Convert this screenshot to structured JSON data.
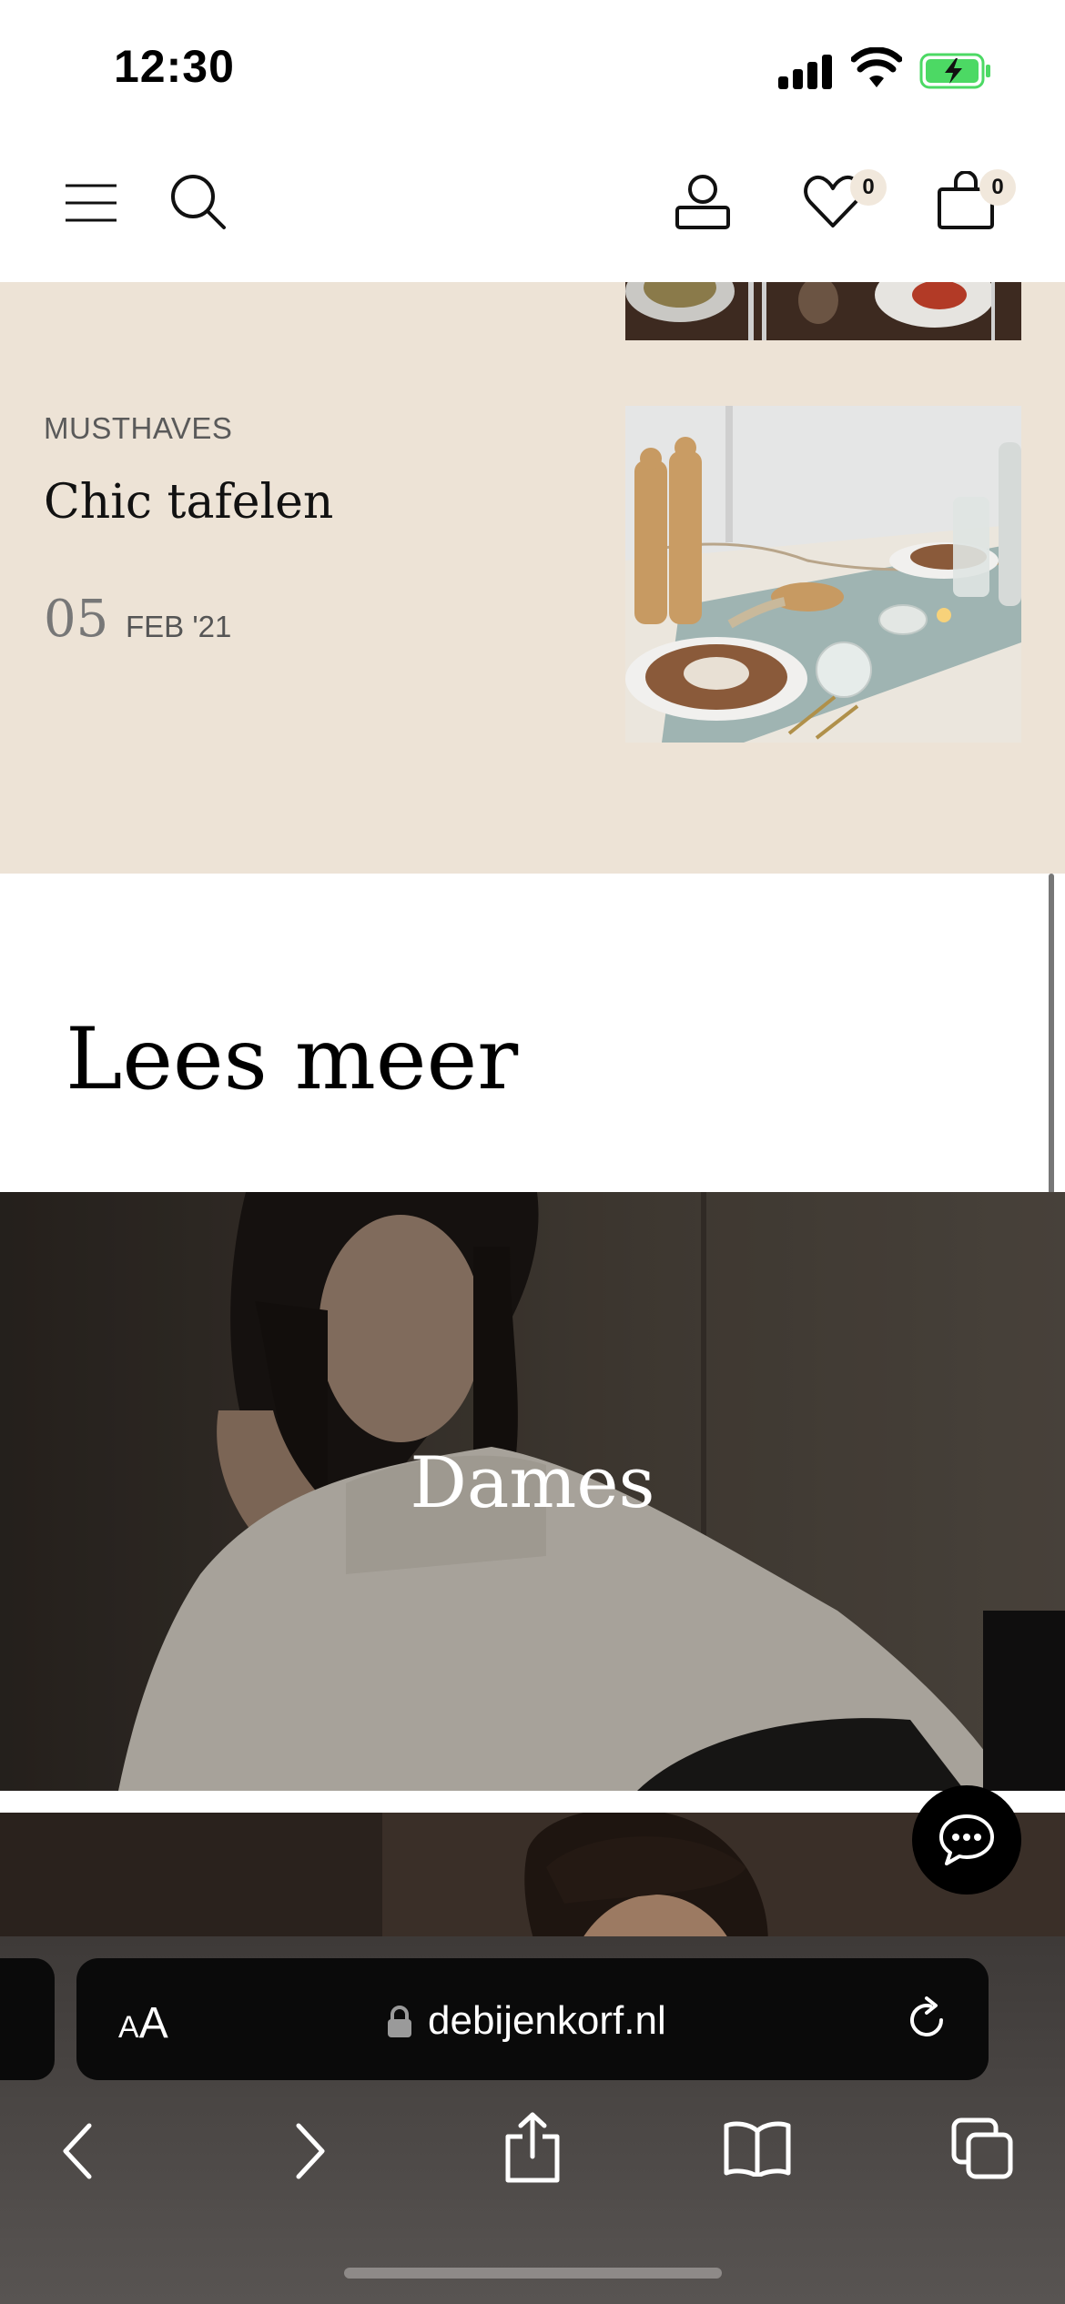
{
  "status_bar": {
    "time": "12:30"
  },
  "header": {
    "wishlist_count": "0",
    "cart_count": "0"
  },
  "article": {
    "category": "MUSTHAVES",
    "title": "Chic tafelen",
    "day": "05",
    "month_year": "FEB '21"
  },
  "read_more": {
    "heading": "Lees meer"
  },
  "banners": {
    "dames_label": "Dames"
  },
  "browser": {
    "aa_small": "A",
    "aa_large": "A",
    "url": "debijenkorf.nl"
  },
  "colors": {
    "beige_background": "#ede3d6",
    "badge_background": "#f1e8dc",
    "battery_green": "#4cd964",
    "browser_chrome": "#484442"
  },
  "icons": [
    "menu-icon",
    "search-icon",
    "account-icon",
    "heart-icon",
    "bag-icon",
    "chat-icon",
    "lock-icon",
    "reload-icon",
    "back-icon",
    "forward-icon",
    "share-icon",
    "bookmarks-icon",
    "tabs-icon"
  ]
}
